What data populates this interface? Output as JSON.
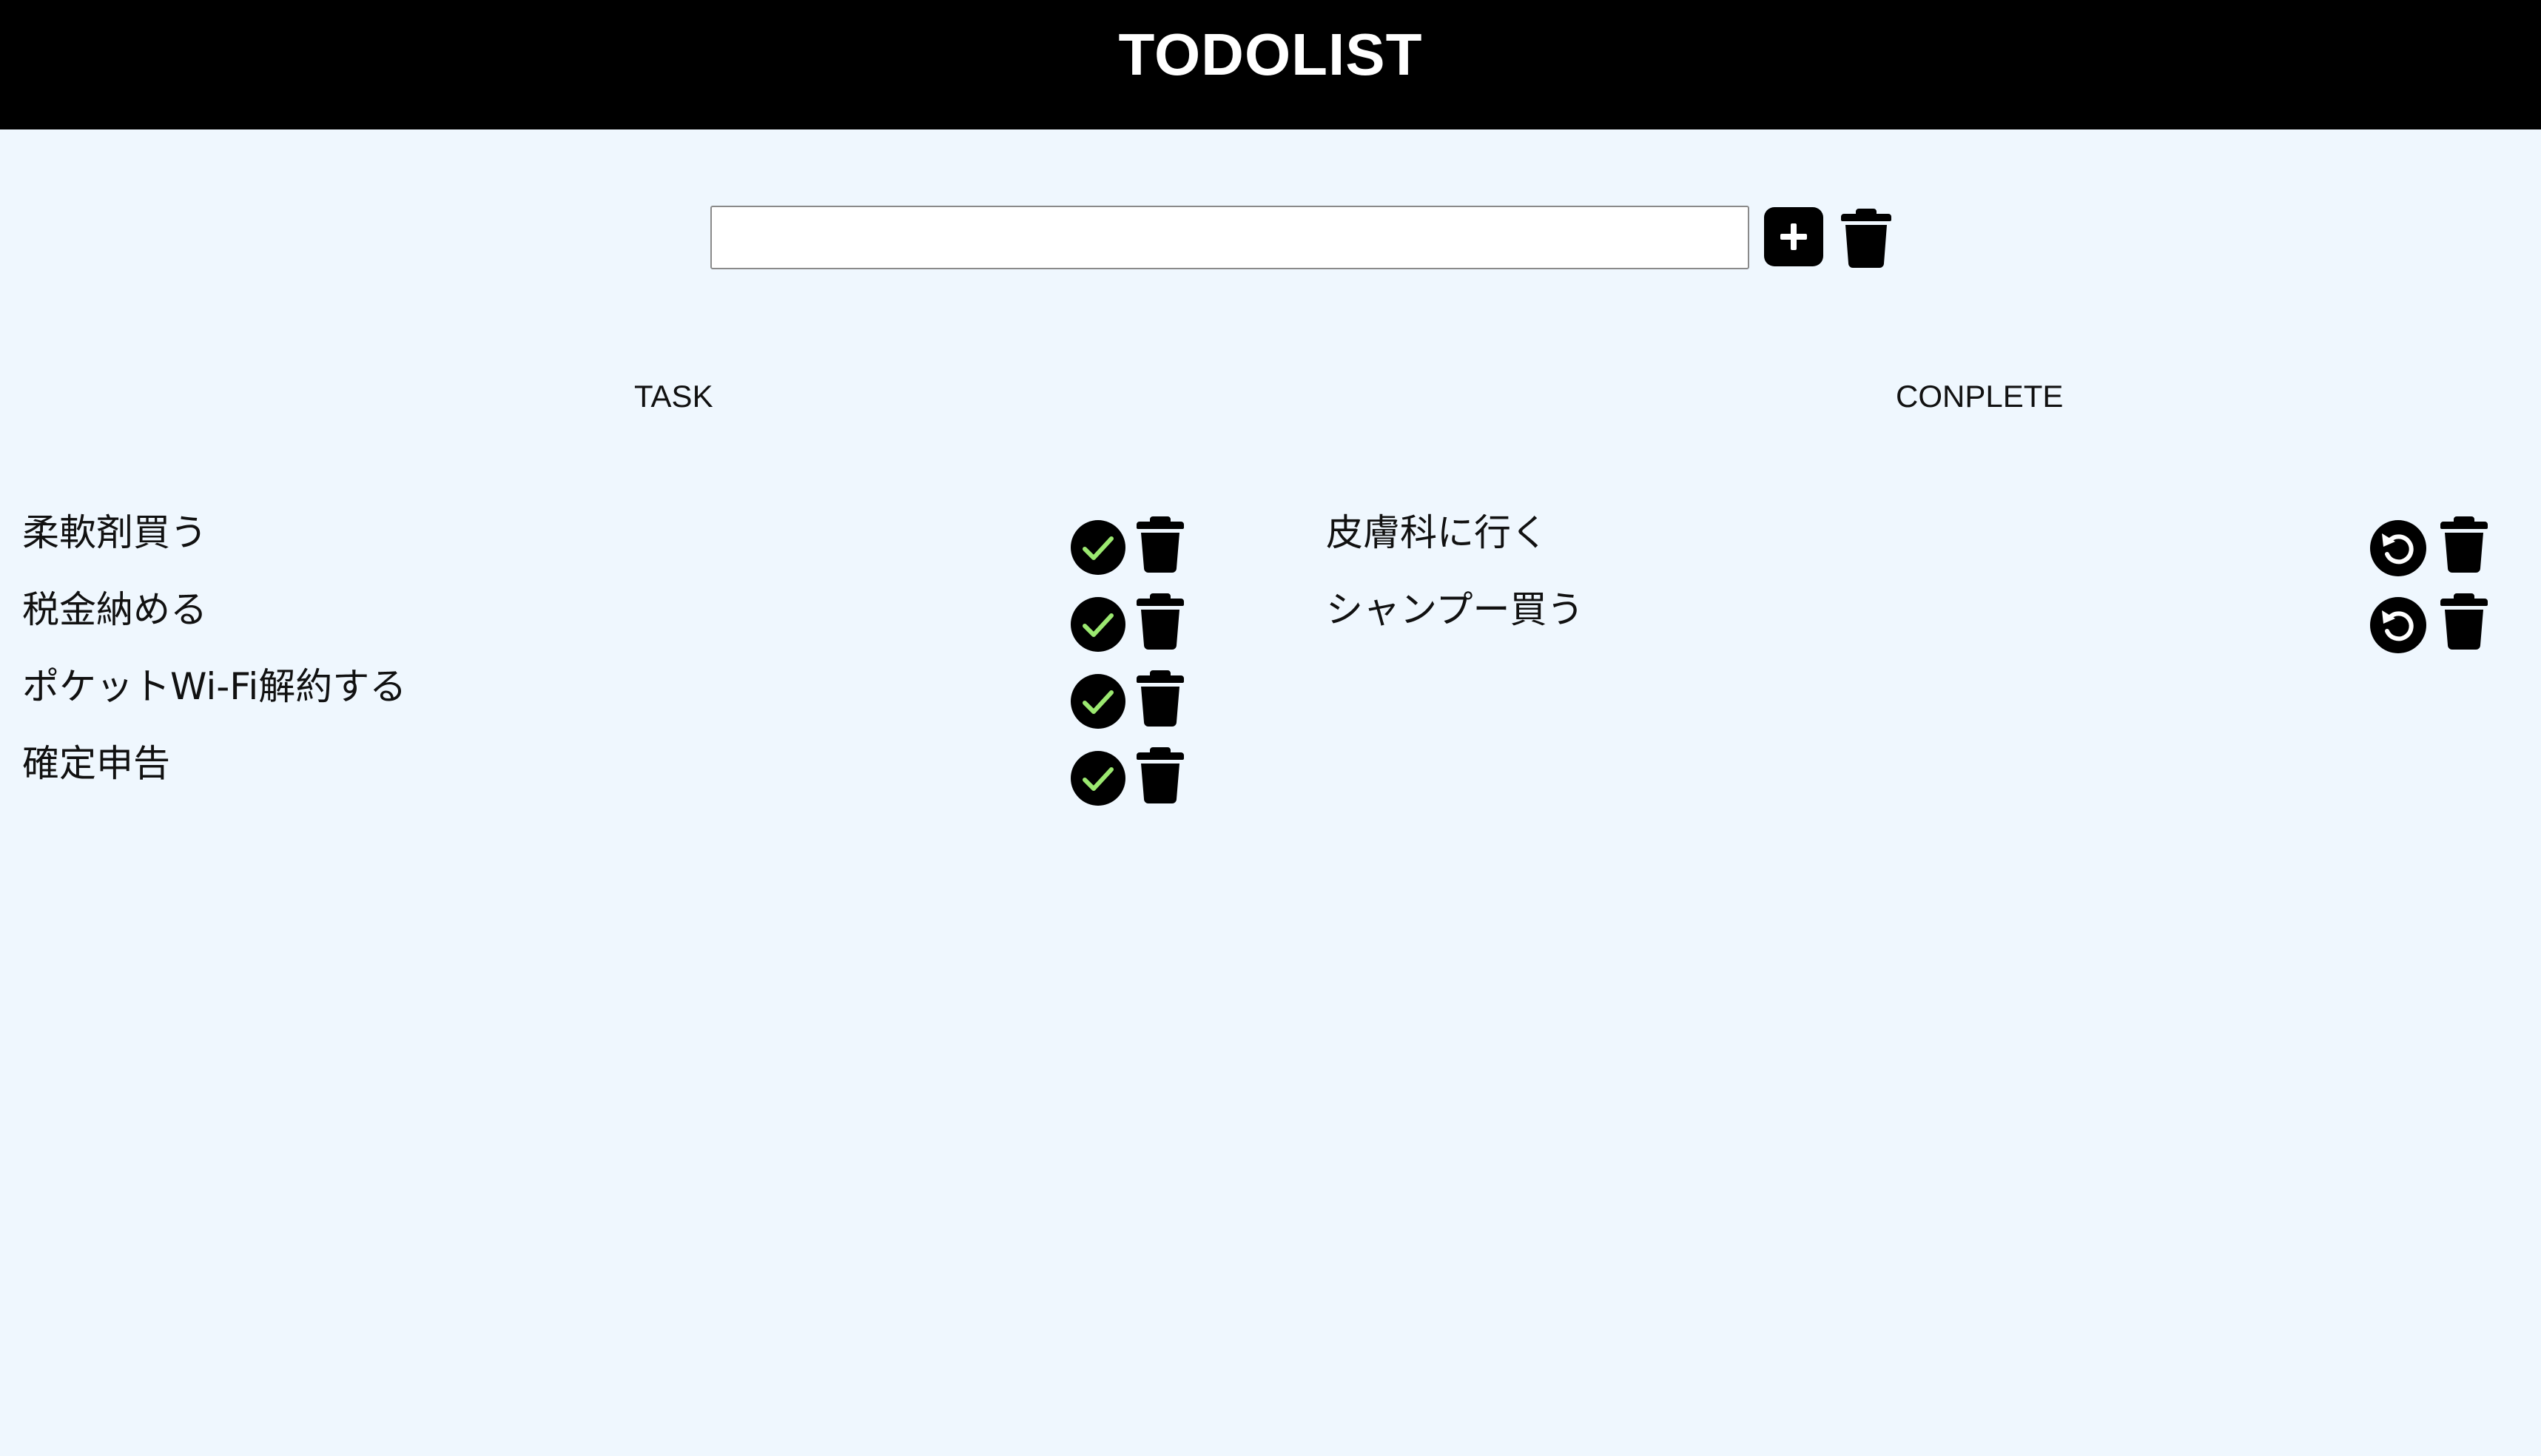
{
  "app": {
    "title": "TODOLIST"
  },
  "input": {
    "value": "",
    "placeholder": ""
  },
  "icons": {
    "add": "plus-icon",
    "clear_all": "trash-icon",
    "complete": "check-circle-icon",
    "undo": "undo-circle-icon",
    "delete": "trash-icon"
  },
  "colors": {
    "header_bg": "#000000",
    "page_bg": "#eff7fe",
    "check_mark": "#9be870"
  },
  "task_column": {
    "title": "TASK",
    "items": [
      "柔軟剤買う",
      "税金納める",
      "ポケットWi-Fi解約する",
      "確定申告"
    ]
  },
  "complete_column": {
    "title": "CONPLETE",
    "items": [
      "皮膚科に行く",
      "シャンプー買う"
    ]
  }
}
